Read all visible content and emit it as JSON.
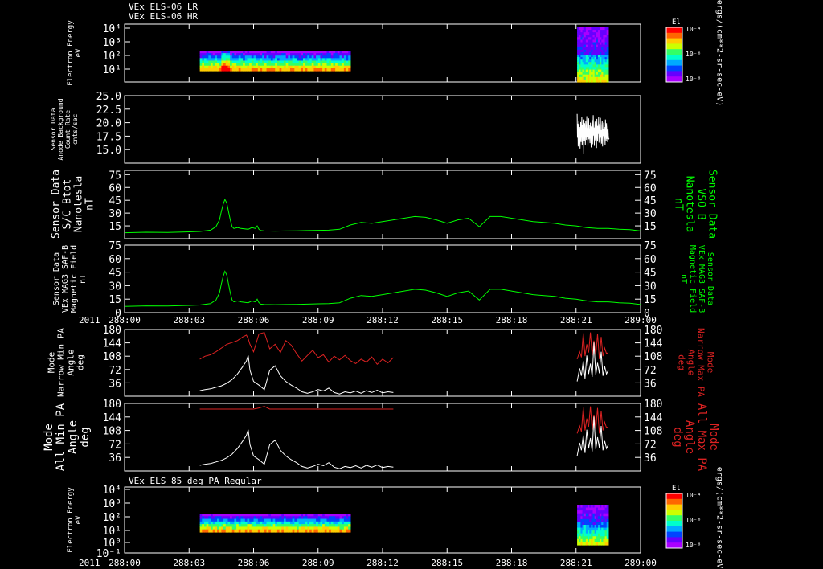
{
  "header": {
    "line1": "VEx ELS-06 LR",
    "line2": "VEx ELS-06 HR",
    "panel7_title": "VEx ELS 85 deg PA Regular",
    "year": "2011"
  },
  "colors": {
    "background": "#000000",
    "axis": "#ffffff",
    "white_trace": "#ffffff",
    "green_trace": "#00ff00",
    "red_trace": "#dd2222"
  },
  "colorbar": {
    "label": "El",
    "ticks": [
      "10⁻⁴",
      "10⁻⁶",
      "10⁻⁸"
    ],
    "units": "ergs/(cm**2-sr-sec-eV)"
  },
  "chart_data": [
    {
      "type": "heatmap",
      "panel": 1,
      "ylabel": [
        "Electron Energy",
        "eV"
      ],
      "yticks": [
        "10⁴",
        "10³",
        "10²",
        "10¹"
      ],
      "segments": [
        {
          "t_start": "288:03:30",
          "t_end": "288:10:30"
        },
        {
          "t_start": "288:21:00",
          "t_end": "288:22:30"
        }
      ]
    },
    {
      "type": "line",
      "panel": 2,
      "ylabel": [
        "Sensor Data",
        "Anode Background",
        "Count Rate",
        "cnts/sec"
      ],
      "yticks": [
        "25.0",
        "22.5",
        "20.0",
        "17.5",
        "15.0"
      ],
      "ylim": [
        12.5,
        25.0
      ],
      "series": [
        {
          "color": "#ffffff",
          "t": [
            1263,
            1264,
            1265,
            1266,
            1267,
            1268,
            1269,
            1270,
            1271,
            1272,
            1273,
            1274,
            1275,
            1276,
            1277,
            1278,
            1279,
            1280,
            1281,
            1282,
            1283,
            1284,
            1285,
            1286,
            1287,
            1288,
            1289,
            1290,
            1291,
            1292,
            1293,
            1294,
            1295,
            1296,
            1297,
            1298,
            1299,
            1300,
            1301,
            1302,
            1303,
            1304,
            1305,
            1306,
            1307,
            1308,
            1309,
            1310,
            1311,
            1312,
            1313,
            1314,
            1315,
            1316,
            1317,
            1318,
            1319,
            1320,
            1321,
            1322,
            1323,
            1324,
            1325,
            1326,
            1327,
            1328,
            1329,
            1330,
            1331,
            1332,
            1333,
            1334,
            1335,
            1336,
            1337,
            1338,
            1339,
            1340,
            1341,
            1342,
            1343,
            1344,
            1345,
            1346,
            1347,
            1348,
            1349,
            1350,
            1351,
            1352
          ],
          "values": [
            21.6,
            17.2,
            19.8,
            15.6,
            18.9,
            20.4,
            16.1,
            19.2,
            15.2,
            17.8,
            20.1,
            16.4,
            18.6,
            21.0,
            15.8,
            19.5,
            17.0,
            14.2,
            18.8,
            20.6,
            16.6,
            19.9,
            17.5,
            15.9,
            20.3,
            18.1,
            16.8,
            21.2,
            17.4,
            19.0,
            15.5,
            18.4,
            20.8,
            16.9,
            19.6,
            17.7,
            16.2,
            20.0,
            18.7,
            15.4,
            19.3,
            17.1,
            20.5,
            16.0,
            18.2,
            21.4,
            17.6,
            19.1,
            15.7,
            18.5,
            20.2,
            16.7,
            19.7,
            17.3,
            15.3,
            20.7,
            18.0,
            16.5,
            19.4,
            17.9,
            21.1,
            16.3,
            18.3,
            19.8,
            15.9,
            20.9,
            17.2,
            18.6,
            16.1,
            19.5,
            20.3,
            15.6,
            18.9,
            17.5,
            20.0,
            16.8,
            19.2,
            17.8,
            15.8,
            20.6,
            18.4,
            16.6,
            19.9,
            17.0,
            18.7,
            16.4,
            19.3,
            17.6,
            16.9,
            17.1
          ]
        }
      ]
    },
    {
      "type": "line",
      "panel": 3,
      "ylabel": [
        "Sensor Data",
        "S/C Btot",
        "Nanotesla",
        "nT"
      ],
      "ylabel_right": [
        "Sensor Data",
        "VSO B",
        "Nanotesla",
        "nT"
      ],
      "yticks": [
        "75",
        "60",
        "45",
        "30",
        "15"
      ],
      "ylim": [
        0,
        75
      ],
      "series": [
        {
          "color": "#00ff00",
          "ref": "b_trace"
        }
      ]
    },
    {
      "type": "line",
      "panel": 4,
      "ylabel": [
        "Sensor Data",
        "VEx MAG3 SAF-B",
        "Magnetic Field",
        "nT"
      ],
      "ylabel_right": [
        "Sensor Data",
        "VEx MAG3 SAF-B",
        "Magnetic Field",
        "nT"
      ],
      "yticks": [
        "75",
        "60",
        "45",
        "30",
        "15",
        "0"
      ],
      "ylim": [
        0,
        75
      ],
      "series": [
        {
          "color": "#00ff00",
          "ref": "b_trace"
        }
      ]
    },
    {
      "type": "line",
      "panel": 5,
      "ylabel": [
        "Mode",
        "Narrow Min PA",
        "Angle",
        "deg"
      ],
      "ylabel_right": [
        "Mode",
        "Narrow Max PA",
        "Angle",
        "deg"
      ],
      "yticks": [
        "180",
        "144",
        "108",
        "72",
        "36"
      ],
      "ylim": [
        0,
        180
      ]
    },
    {
      "type": "line",
      "panel": 6,
      "ylabel": [
        "Mode",
        "All Min PA",
        "Angle",
        "deg"
      ],
      "ylabel_right": [
        "Mode",
        "All Max PA",
        "Angle",
        "deg"
      ],
      "yticks": [
        "180",
        "144",
        "108",
        "72",
        "36"
      ],
      "ylim": [
        0,
        180
      ]
    },
    {
      "type": "heatmap",
      "panel": 7,
      "ylabel": [
        "Electron Energy",
        "eV"
      ],
      "yticks": [
        "10⁴",
        "10³",
        "10²",
        "10¹",
        "10⁰",
        "10⁻¹"
      ]
    }
  ],
  "b_trace": {
    "t": [
      0,
      60,
      120,
      180,
      210,
      240,
      255,
      265,
      270,
      275,
      280,
      285,
      290,
      295,
      300,
      305,
      310,
      315,
      325,
      345,
      355,
      365,
      370,
      375,
      380,
      390,
      420,
      450,
      480,
      510,
      540,
      570,
      600,
      630,
      660,
      690,
      720,
      750,
      780,
      810,
      840,
      870,
      900,
      930,
      960,
      990,
      1020,
      1050,
      1080,
      1110,
      1140,
      1170,
      1200,
      1230,
      1260,
      1290,
      1320,
      1350,
      1380,
      1410,
      1440
    ],
    "values": [
      7,
      7.5,
      7.3,
      8,
      8.5,
      10,
      14,
      22,
      32,
      40,
      46,
      42,
      32,
      22,
      14,
      12,
      12.5,
      13,
      12,
      11,
      13,
      12,
      15,
      11,
      9.5,
      9,
      8.8,
      9,
      9.2,
      9.5,
      9.8,
      10,
      11,
      16,
      19,
      18,
      20,
      22,
      24,
      26,
      25,
      22,
      18,
      22,
      24,
      14,
      26,
      26,
      24,
      22,
      20,
      19,
      18,
      16,
      15,
      13,
      12,
      12,
      11,
      10.5,
      9
    ]
  },
  "pa_trace": {
    "t_narrow": [
      0,
      15,
      30,
      45,
      60,
      75,
      90,
      105,
      120,
      130,
      135,
      140,
      150,
      165,
      180,
      195,
      210,
      225,
      240,
      255,
      270,
      285,
      300,
      315,
      330,
      345,
      360,
      375,
      390,
      405,
      420,
      435,
      450,
      465,
      480,
      495,
      510,
      525,
      540
    ],
    "min": [
      15,
      18,
      20,
      24,
      28,
      35,
      45,
      60,
      80,
      95,
      110,
      70,
      40,
      30,
      18,
      70,
      82,
      55,
      40,
      30,
      22,
      12,
      8,
      12,
      18,
      14,
      22,
      10,
      6,
      12,
      9,
      14,
      8,
      15,
      10,
      16,
      9,
      12,
      10
    ],
    "max": [
      100,
      108,
      112,
      120,
      130,
      140,
      145,
      150,
      160,
      165,
      155,
      140,
      120,
      168,
      172,
      128,
      140,
      118,
      150,
      138,
      115,
      95,
      110,
      124,
      104,
      112,
      92,
      108,
      98,
      110,
      96,
      88,
      100,
      92,
      106,
      86,
      100,
      90,
      104
    ],
    "t_end": [
      1263,
      1270,
      1275,
      1280,
      1285,
      1290,
      1295,
      1300,
      1305,
      1310,
      1315,
      1320,
      1325,
      1330,
      1335,
      1340,
      1345,
      1350
    ],
    "min_end": [
      40,
      75,
      55,
      95,
      48,
      110,
      60,
      88,
      52,
      145,
      58,
      90,
      62,
      120,
      55,
      80,
      60,
      70
    ],
    "max_end": [
      100,
      120,
      105,
      170,
      108,
      140,
      118,
      172,
      110,
      150,
      112,
      168,
      100,
      160,
      108,
      130,
      115,
      118
    ]
  },
  "x_axis": {
    "tick_labels": [
      "288:00",
      "288:03",
      "288:06",
      "288:09",
      "288:12",
      "288:15",
      "288:18",
      "288:21",
      "289:00"
    ],
    "panel4_tick_labels": [
      "288:00",
      "288:03",
      "288:06",
      "288:09",
      "288:12",
      "288:15",
      "288:18",
      "288:21",
      "289:00"
    ]
  }
}
